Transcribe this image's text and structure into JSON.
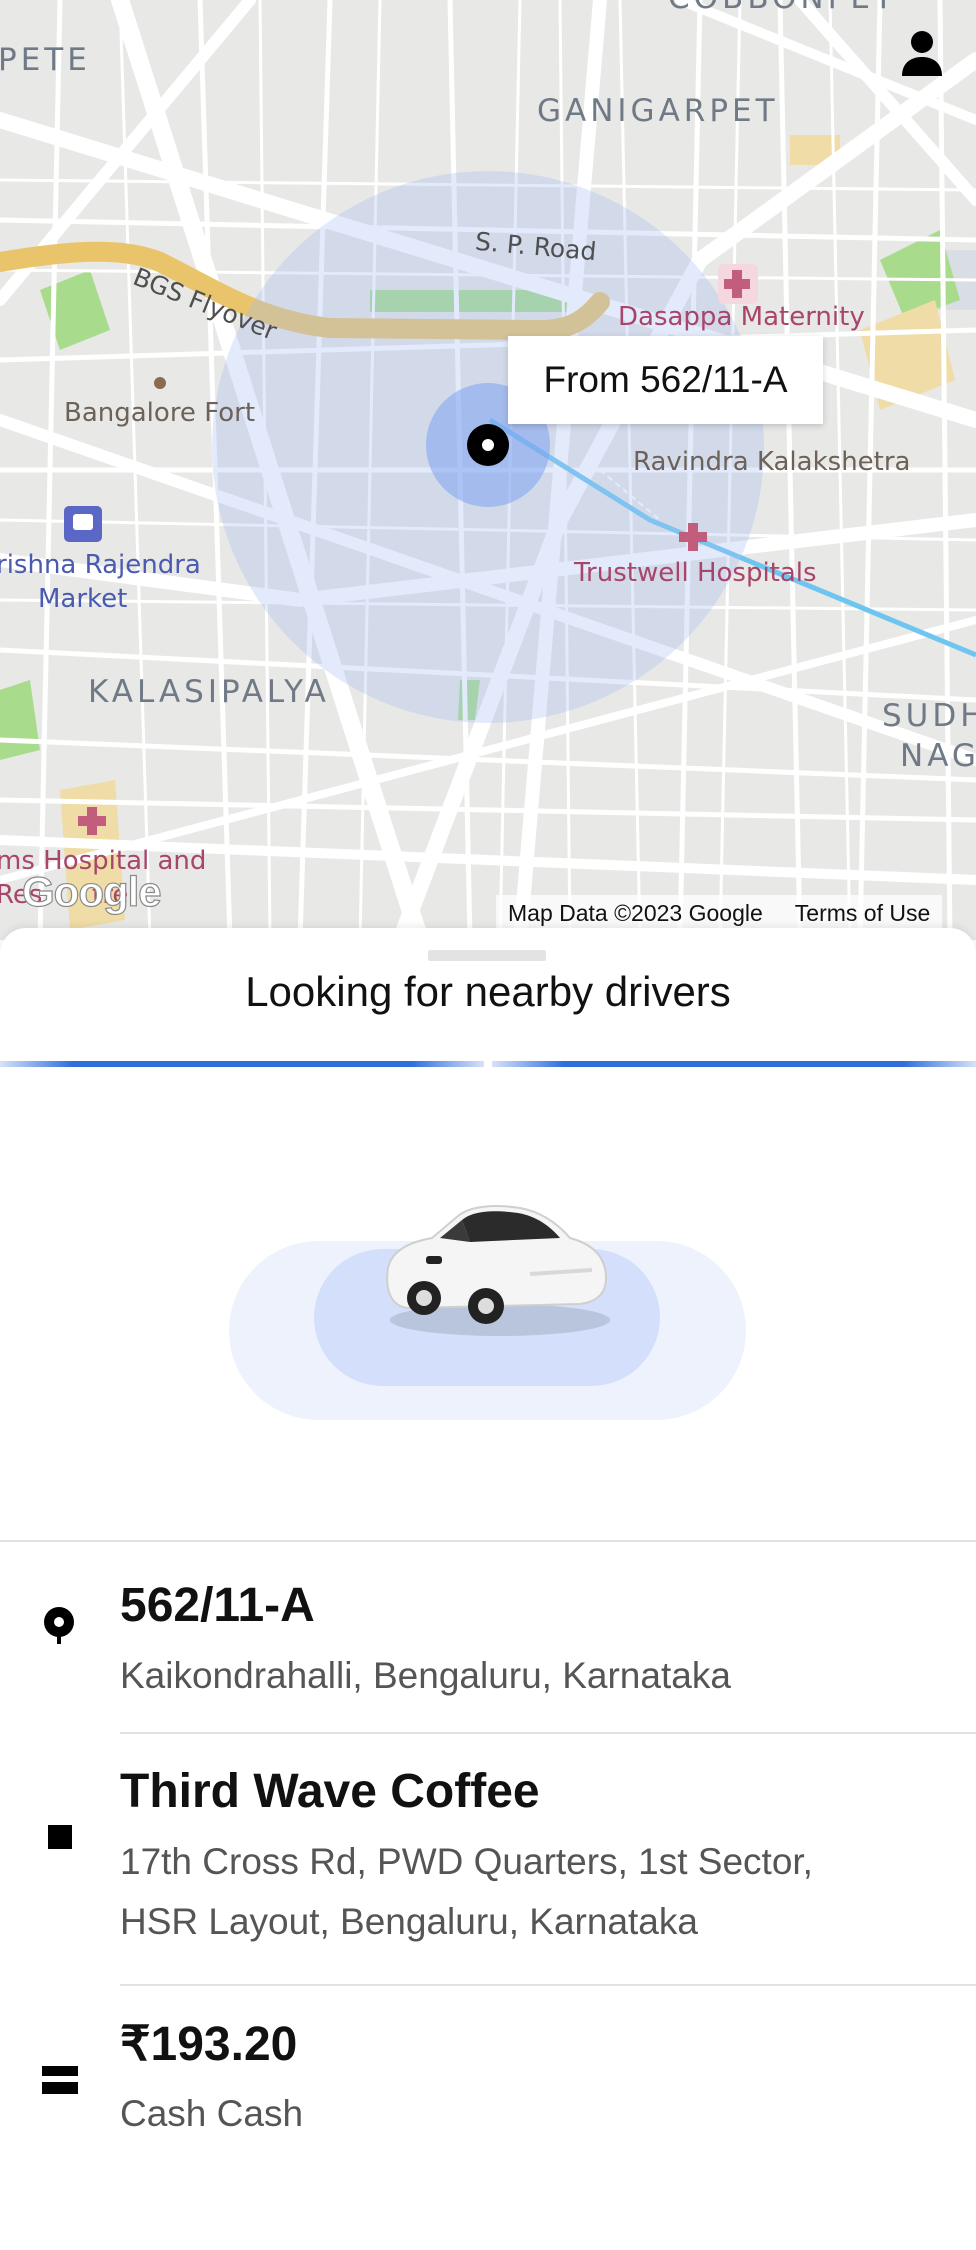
{
  "map": {
    "labels": {
      "area_top_left": "PETE",
      "area_top_right": "COBBONPET",
      "area_ganigarpet": "GANIGARPET",
      "road_sp": "S. P. Road",
      "road_bgs": "BGS Flyover",
      "poi_dasappa": "Dasappa Maternity",
      "poi_ravindra": "Ravindra Kalakshetra",
      "poi_trustwell": "Trustwell Hospitals",
      "place_fort": "Bangalore Fort",
      "transit_kr_market_line1": "rishna Rajendra",
      "transit_kr_market_line2": "Market",
      "area_kalasipalya": "KALASIPALYA",
      "area_sudh_line1": "SUDH",
      "area_sudh_line2": "NAG",
      "poi_hospital_line1": "ms Hospital and",
      "poi_hospital_line2": "Res      tre"
    },
    "from_callout": "From 562/11-A",
    "google_logo": "Google",
    "footer": {
      "map_data": "Map Data ©2023 Google",
      "terms": "Terms of Use"
    },
    "colors": {
      "road": "#ffffff",
      "flyover": "#e9c46a",
      "park": "#a8dc8c",
      "radius": "#a7bff2",
      "pin": "#000000"
    }
  },
  "sheet": {
    "title": "Looking for nearby drivers",
    "accent": "#2f6fdc"
  },
  "trip": {
    "pickup": {
      "icon": "pickup-pin-icon",
      "title": "562/11-A",
      "address": "Kaikondrahalli, Bengaluru, Karnataka"
    },
    "dropoff": {
      "icon": "dropoff-square-icon",
      "title": "Third Wave Coffee",
      "address_line1": "17th Cross Rd, PWD Quarters, 1st Sector,",
      "address_line2": "HSR Layout, Bengaluru, Karnataka"
    },
    "payment": {
      "icon": "cash-icon",
      "amount": "₹193.20",
      "method": "Cash Cash"
    }
  }
}
